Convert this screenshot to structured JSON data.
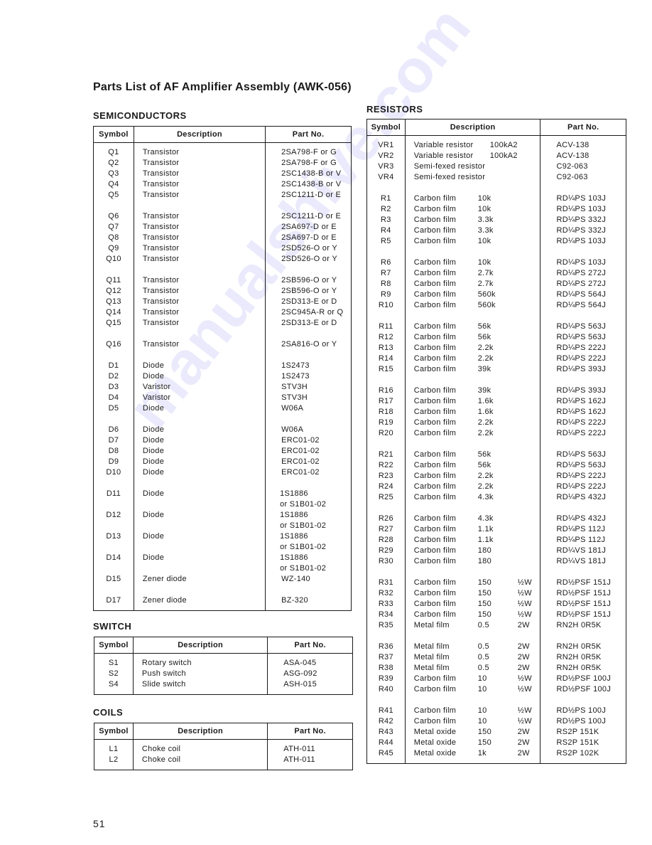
{
  "title": "Parts List of AF Amplifier Assembly (AWK-056)",
  "page_number": "51",
  "watermark": "manualshive.com",
  "headers": {
    "symbol": "Symbol",
    "description": "Description",
    "part_no": "Part No."
  },
  "semiconductors": {
    "title": "SEMICONDUCTORS",
    "rows": [
      {
        "symbol": "Q1",
        "description": "Transistor",
        "part_no": "2SA798-F or G"
      },
      {
        "symbol": "Q2",
        "description": "Transistor",
        "part_no": "2SA798-F or G"
      },
      {
        "symbol": "Q3",
        "description": "Transistor",
        "part_no": "2SC1438-B or V"
      },
      {
        "symbol": "Q4",
        "description": "Transistor",
        "part_no": "2SC1438-B or V"
      },
      {
        "symbol": "Q5",
        "description": "Transistor",
        "part_no": "2SC1211-D or E"
      },
      {
        "symbol": "Q6",
        "description": "Transistor",
        "part_no": "2SC1211-D or E"
      },
      {
        "symbol": "Q7",
        "description": "Transistor",
        "part_no": "2SA697-D or E"
      },
      {
        "symbol": "Q8",
        "description": "Transistor",
        "part_no": "2SA697-D or E"
      },
      {
        "symbol": "Q9",
        "description": "Transistor",
        "part_no": "2SD526-O or Y"
      },
      {
        "symbol": "Q10",
        "description": "Transistor",
        "part_no": "2SD526-O or Y"
      },
      {
        "symbol": "Q11",
        "description": "Transistor",
        "part_no": "2SB596-O or Y"
      },
      {
        "symbol": "Q12",
        "description": "Transistor",
        "part_no": "2SB596-O or Y"
      },
      {
        "symbol": "Q13",
        "description": "Transistor",
        "part_no": "2SD313-E or D"
      },
      {
        "symbol": "Q14",
        "description": "Transistor",
        "part_no": "2SC945A-R or Q"
      },
      {
        "symbol": "Q15",
        "description": "Transistor",
        "part_no": "2SD313-E or D"
      },
      {
        "symbol": "Q16",
        "description": "Transistor",
        "part_no": "2SA816-O or Y"
      },
      {
        "symbol": "D1",
        "description": "Diode",
        "part_no": "1S2473"
      },
      {
        "symbol": "D2",
        "description": "Diode",
        "part_no": "1S2473"
      },
      {
        "symbol": "D3",
        "description": "Varistor",
        "part_no": "STV3H"
      },
      {
        "symbol": "D4",
        "description": "Varistor",
        "part_no": "STV3H"
      },
      {
        "symbol": "D5",
        "description": "Diode",
        "part_no": "W06A"
      },
      {
        "symbol": "D6",
        "description": "Diode",
        "part_no": "W06A"
      },
      {
        "symbol": "D7",
        "description": "Diode",
        "part_no": "ERC01-02"
      },
      {
        "symbol": "D8",
        "description": "Diode",
        "part_no": "ERC01-02"
      },
      {
        "symbol": "D9",
        "description": "Diode",
        "part_no": "ERC01-02"
      },
      {
        "symbol": "D10",
        "description": "Diode",
        "part_no": "ERC01-02"
      },
      {
        "symbol": "D11",
        "description": "Diode",
        "part_no": "1S1886",
        "part_no_alt": "or S1B01-02"
      },
      {
        "symbol": "D12",
        "description": "Diode",
        "part_no": "1S1886",
        "part_no_alt": "or S1B01-02"
      },
      {
        "symbol": "D13",
        "description": "Diode",
        "part_no": "1S1886",
        "part_no_alt": "or S1B01-02"
      },
      {
        "symbol": "D14",
        "description": "Diode",
        "part_no": "1S1886",
        "part_no_alt": "or S1B01-02"
      },
      {
        "symbol": "D15",
        "description": "Zener diode",
        "part_no": "WZ-140"
      },
      {
        "symbol": "D17",
        "description": "Zener diode",
        "part_no": "BZ-320"
      }
    ]
  },
  "switch": {
    "title": "SWITCH",
    "rows": [
      {
        "symbol": "S1",
        "description": "Rotary switch",
        "part_no": "ASA-045"
      },
      {
        "symbol": "S2",
        "description": "Push switch",
        "part_no": "ASG-092"
      },
      {
        "symbol": "S4",
        "description": "Slide switch",
        "part_no": "ASH-015"
      }
    ]
  },
  "coils": {
    "title": "COILS",
    "rows": [
      {
        "symbol": "L1",
        "description": "Choke coil",
        "part_no": "ATH-011"
      },
      {
        "symbol": "L2",
        "description": "Choke coil",
        "part_no": "ATH-011"
      }
    ]
  },
  "resistors": {
    "title": "RESISTORS",
    "rows": [
      {
        "symbol": "VR1",
        "description": "Variable resistor",
        "value": "100kA2",
        "wattage": "",
        "part_no": "ACV-138"
      },
      {
        "symbol": "VR2",
        "description": "Variable resistor",
        "value": "100kA2",
        "wattage": "",
        "part_no": "ACV-138"
      },
      {
        "symbol": "VR3",
        "description": "Semi-fexed resistor",
        "value": "",
        "wattage": "",
        "part_no": "C92-063"
      },
      {
        "symbol": "VR4",
        "description": "Semi-fexed resistor",
        "value": "",
        "wattage": "",
        "part_no": "C92-063"
      },
      {
        "symbol": "R1",
        "description": "Carbon film",
        "value": "10k",
        "wattage": "",
        "part_no": "RD¼PS 103J"
      },
      {
        "symbol": "R2",
        "description": "Carbon film",
        "value": "10k",
        "wattage": "",
        "part_no": "RD¼PS 103J"
      },
      {
        "symbol": "R3",
        "description": "Carbon film",
        "value": "3.3k",
        "wattage": "",
        "part_no": "RD¼PS 332J"
      },
      {
        "symbol": "R4",
        "description": "Carbon film",
        "value": "3.3k",
        "wattage": "",
        "part_no": "RD¼PS 332J"
      },
      {
        "symbol": "R5",
        "description": "Carbon film",
        "value": "10k",
        "wattage": "",
        "part_no": "RD¼PS 103J"
      },
      {
        "symbol": "R6",
        "description": "Carbon film",
        "value": "10k",
        "wattage": "",
        "part_no": "RD¼PS 103J"
      },
      {
        "symbol": "R7",
        "description": "Carbon film",
        "value": "2.7k",
        "wattage": "",
        "part_no": "RD¼PS 272J"
      },
      {
        "symbol": "R8",
        "description": "Carbon film",
        "value": "2.7k",
        "wattage": "",
        "part_no": "RD¼PS 272J"
      },
      {
        "symbol": "R9",
        "description": "Carbon film",
        "value": "560k",
        "wattage": "",
        "part_no": "RD¼PS 564J"
      },
      {
        "symbol": "R10",
        "description": "Carbon film",
        "value": "560k",
        "wattage": "",
        "part_no": "RD¼PS 564J"
      },
      {
        "symbol": "R11",
        "description": "Carbon film",
        "value": "56k",
        "wattage": "",
        "part_no": "RD¼PS 563J"
      },
      {
        "symbol": "R12",
        "description": "Carbon film",
        "value": "56k",
        "wattage": "",
        "part_no": "RD¼PS 563J"
      },
      {
        "symbol": "R13",
        "description": "Carbon film",
        "value": "2.2k",
        "wattage": "",
        "part_no": "RD¼PS 222J"
      },
      {
        "symbol": "R14",
        "description": "Carbon film",
        "value": "2.2k",
        "wattage": "",
        "part_no": "RD¼PS 222J"
      },
      {
        "symbol": "R15",
        "description": "Carbon film",
        "value": "39k",
        "wattage": "",
        "part_no": "RD¼PS 393J"
      },
      {
        "symbol": "R16",
        "description": "Carbon film",
        "value": "39k",
        "wattage": "",
        "part_no": "RD¼PS 393J"
      },
      {
        "symbol": "R17",
        "description": "Carbon film",
        "value": "1.6k",
        "wattage": "",
        "part_no": "RD¼PS 162J"
      },
      {
        "symbol": "R18",
        "description": "Carbon film",
        "value": "1.6k",
        "wattage": "",
        "part_no": "RD¼PS 162J"
      },
      {
        "symbol": "R19",
        "description": "Carbon film",
        "value": "2.2k",
        "wattage": "",
        "part_no": "RD¼PS 222J"
      },
      {
        "symbol": "R20",
        "description": "Carbon film",
        "value": "2.2k",
        "wattage": "",
        "part_no": "RD¼PS 222J"
      },
      {
        "symbol": "R21",
        "description": "Carbon film",
        "value": "56k",
        "wattage": "",
        "part_no": "RD¼PS 563J"
      },
      {
        "symbol": "R22",
        "description": "Carbon film",
        "value": "56k",
        "wattage": "",
        "part_no": "RD¼PS 563J"
      },
      {
        "symbol": "R23",
        "description": "Carbon film",
        "value": "2.2k",
        "wattage": "",
        "part_no": "RD¼PS 222J"
      },
      {
        "symbol": "R24",
        "description": "Carbon film",
        "value": "2.2k",
        "wattage": "",
        "part_no": "RD¼PS 222J"
      },
      {
        "symbol": "R25",
        "description": "Carbon film",
        "value": "4.3k",
        "wattage": "",
        "part_no": "RD¼PS 432J"
      },
      {
        "symbol": "R26",
        "description": "Carbon film",
        "value": "4.3k",
        "wattage": "",
        "part_no": "RD¼PS 432J"
      },
      {
        "symbol": "R27",
        "description": "Carbon film",
        "value": "1.1k",
        "wattage": "",
        "part_no": "RD¼PS 112J"
      },
      {
        "symbol": "R28",
        "description": "Carbon film",
        "value": "1.1k",
        "wattage": "",
        "part_no": "RD¼PS 112J"
      },
      {
        "symbol": "R29",
        "description": "Carbon film",
        "value": "180",
        "wattage": "",
        "part_no": "RD¼VS 181J"
      },
      {
        "symbol": "R30",
        "description": "Carbon film",
        "value": "180",
        "wattage": "",
        "part_no": "RD¼VS 181J"
      },
      {
        "symbol": "R31",
        "description": "Carbon film",
        "value": "150",
        "wattage": "½W",
        "part_no": "RD½PSF 151J"
      },
      {
        "symbol": "R32",
        "description": "Carbon film",
        "value": "150",
        "wattage": "½W",
        "part_no": "RD½PSF 151J"
      },
      {
        "symbol": "R33",
        "description": "Carbon film",
        "value": "150",
        "wattage": "½W",
        "part_no": "RD½PSF 151J"
      },
      {
        "symbol": "R34",
        "description": "Carbon film",
        "value": "150",
        "wattage": "½W",
        "part_no": "RD½PSF 151J"
      },
      {
        "symbol": "R35",
        "description": "Metal film",
        "value": "0.5",
        "wattage": "2W",
        "part_no": "RN2H 0R5K"
      },
      {
        "symbol": "R36",
        "description": "Metal film",
        "value": "0.5",
        "wattage": "2W",
        "part_no": "RN2H 0R5K"
      },
      {
        "symbol": "R37",
        "description": "Metal film",
        "value": "0.5",
        "wattage": "2W",
        "part_no": "RN2H 0R5K"
      },
      {
        "symbol": "R38",
        "description": "Metal film",
        "value": "0.5",
        "wattage": "2W",
        "part_no": "RN2H 0R5K"
      },
      {
        "symbol": "R39",
        "description": "Carbon film",
        "value": "10",
        "wattage": "½W",
        "part_no": "RD½PSF 100J"
      },
      {
        "symbol": "R40",
        "description": "Carbon film",
        "value": "10",
        "wattage": "½W",
        "part_no": "RD½PSF 100J"
      },
      {
        "symbol": "R41",
        "description": "Carbon film",
        "value": "10",
        "wattage": "½W",
        "part_no": "RD½PS 100J"
      },
      {
        "symbol": "R42",
        "description": "Carbon film",
        "value": "10",
        "wattage": "½W",
        "part_no": "RD½PS 100J"
      },
      {
        "symbol": "R43",
        "description": "Metal oxide",
        "value": "150",
        "wattage": "2W",
        "part_no": "RS2P 151K"
      },
      {
        "symbol": "R44",
        "description": "Metal oxide",
        "value": "150",
        "wattage": "2W",
        "part_no": "RS2P 151K"
      },
      {
        "symbol": "R45",
        "description": "Metal oxide",
        "value": "1k",
        "wattage": "2W",
        "part_no": "RS2P 102K"
      }
    ]
  }
}
